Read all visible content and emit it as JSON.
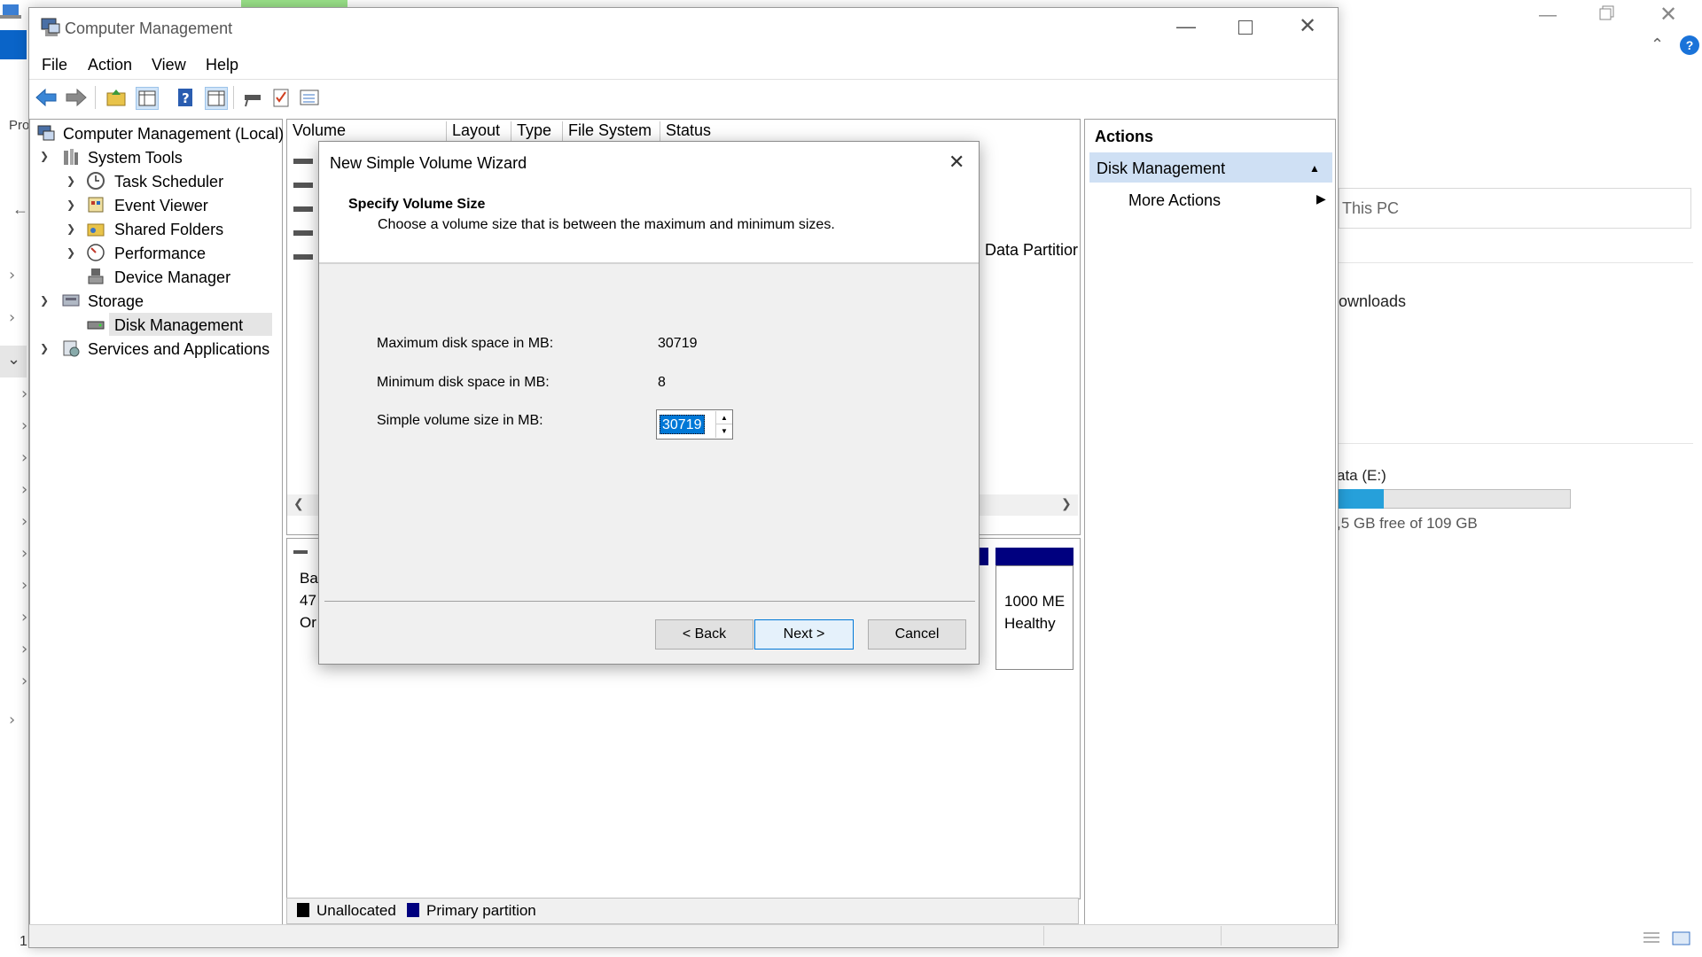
{
  "window": {
    "title": "Computer Management",
    "menu": [
      "File",
      "Action",
      "View",
      "Help"
    ]
  },
  "tree": {
    "root": "Computer Management (Local)",
    "system_tools": "System Tools",
    "task_scheduler": "Task Scheduler",
    "event_viewer": "Event Viewer",
    "shared_folders": "Shared Folders",
    "performance": "Performance",
    "device_manager": "Device Manager",
    "storage": "Storage",
    "disk_management": "Disk Management",
    "services_apps": "Services and Applications"
  },
  "volume_list": {
    "columns": [
      "Volume",
      "Layout",
      "Type",
      "File System",
      "Status"
    ],
    "partial_row_text": "Data Partitior"
  },
  "disk_map": {
    "disk_label_lines": [
      "Ba",
      "47",
      "Or"
    ],
    "partition_size": "1000 ME",
    "partition_status": "Healthy"
  },
  "legend": {
    "unallocated": "Unallocated",
    "primary": "Primary partition",
    "unallocated_color": "#000000",
    "primary_color": "#00007f"
  },
  "actions": {
    "header": "Actions",
    "section": "Disk Management",
    "more": "More Actions"
  },
  "wizard": {
    "title": "New Simple Volume Wizard",
    "heading": "Specify Volume Size",
    "subheading": "Choose a volume size that is between the maximum and minimum sizes.",
    "max_label": "Maximum disk space in MB:",
    "max_value": "30719",
    "min_label": "Minimum disk space in MB:",
    "min_value": "8",
    "size_label": "Simple volume size in MB:",
    "size_value": "30719",
    "back": "< Back",
    "next": "Next >",
    "cancel": "Cancel"
  },
  "background": {
    "address_text": "This PC",
    "downloads_partial": "ownloads",
    "drive_label_partial": "ata (E:)",
    "drive_free_partial": ",5 GB free of 109 GB",
    "drive_used_fraction": 0.2,
    "left_partial_1": "Pro",
    "status_left": "1"
  }
}
